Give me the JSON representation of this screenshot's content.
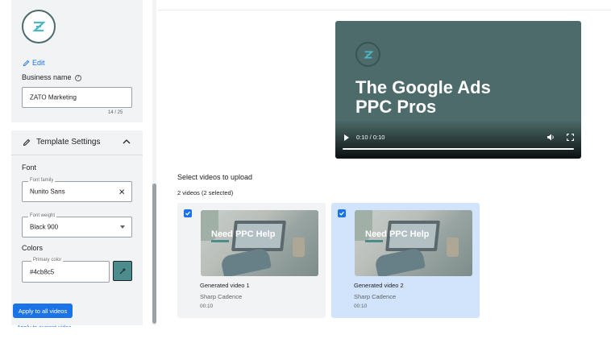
{
  "sidebar": {
    "edit_label": "Edit",
    "business_name_label": "Business name",
    "business_name_value": "ZATO Marketing",
    "business_name_counter": "14 / 25",
    "template_settings_label": "Template Settings",
    "font_section_label": "Font",
    "font_family_legend": "Font family",
    "font_family_value": "Nunito Sans",
    "font_weight_legend": "Font weight",
    "font_weight_value": "Black 900",
    "colors_section_label": "Colors",
    "primary_color_legend": "Primary color",
    "primary_color_value": "#4cb8c5",
    "apply_all_label": "Apply to all videos",
    "apply_current_label": "Apply to current video"
  },
  "player": {
    "title_line1": "The Google Ads",
    "title_line2": "PPC Pros",
    "time": "0:10 / 0:10",
    "progress": 1.0
  },
  "selection": {
    "title": "Select videos to upload",
    "count": "2 videos (2 selected)"
  },
  "videos": [
    {
      "thumb_text_line1": "Need PPC Help",
      "name": "Generated video 1",
      "author": "Sharp Cadence",
      "duration": "00:10",
      "selected": true
    },
    {
      "thumb_text_line1": "Need PPC Help",
      "name": "Generated video 2",
      "author": "Sharp Cadence",
      "duration": "00:10",
      "selected": true
    }
  ],
  "colors": {
    "brand_teal": "#4c6b6a",
    "accent_blue": "#1a73e8",
    "picker_swatch": "#4c8c8c",
    "selected_card": "#d2e3fc"
  },
  "icons": [
    "zato-logo-icon",
    "pencil-icon",
    "help-icon",
    "chevron-up-icon",
    "close-icon",
    "dropdown-caret-icon",
    "eyedropper-icon",
    "play-icon",
    "volume-icon",
    "fullscreen-icon",
    "checkbox-checked-icon"
  ]
}
